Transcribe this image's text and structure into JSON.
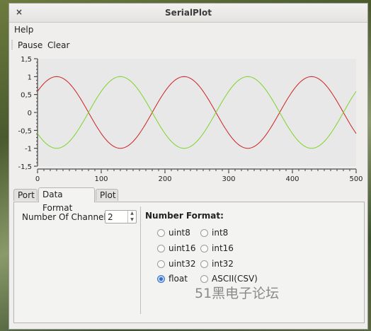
{
  "window": {
    "title": "SerialPlot",
    "close_glyph": "×"
  },
  "menu": {
    "help": "Help"
  },
  "toolbar": {
    "pause": "Pause",
    "clear": "Clear"
  },
  "tabs": [
    "Port",
    "Data Format",
    "Plot"
  ],
  "data_format": {
    "channels_label": "Number Of Channels:",
    "channels_value": "2",
    "number_format_title": "Number Format:",
    "options": [
      "uint8",
      "int8",
      "uint16",
      "int16",
      "uint32",
      "int32",
      "float",
      "ASCII(CSV)"
    ],
    "selected": "float"
  },
  "watermark": "51黑电子论坛",
  "colors": {
    "series_red": "#cc2222",
    "series_green": "#7cd42a",
    "selected_radio": "#2f6fc6"
  },
  "chart_data": {
    "type": "line",
    "xlim": [
      0,
      500
    ],
    "ylim": [
      -1.5,
      1.5
    ],
    "x_ticks": [
      "0",
      "100",
      "200",
      "300",
      "400",
      "500"
    ],
    "y_ticks": [
      "1,5",
      "1",
      "0,5",
      "0",
      "-0,5",
      "-1",
      "-1,5"
    ],
    "series": [
      {
        "color": "#cc2222",
        "amplitude": 1,
        "period": 200,
        "value_at_0": 0.65,
        "peak_x": 30
      },
      {
        "color": "#7cd42a",
        "amplitude": 1,
        "period": 200,
        "value_at_0": -0.65,
        "peak_x": 130
      }
    ]
  }
}
